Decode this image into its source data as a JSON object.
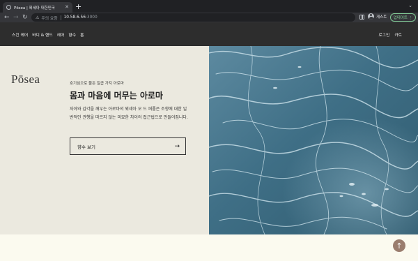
{
  "browser": {
    "tab_title": "Pōsea | 푀세아 대한민국",
    "tab_close": "✕",
    "new_tab": "+",
    "window_chevron": "⌄",
    "address": {
      "security_label": "주의 요함",
      "host": "10.58.6.56",
      "port": ":3000"
    },
    "profile_name": "게스트",
    "update_label": "업데이트 ⋮"
  },
  "site": {
    "nav": [
      "스킨 케어",
      "바디 & 핸드",
      "헤어",
      "향수",
      "홈"
    ],
    "account_nav": [
      "로그인",
      "카트"
    ]
  },
  "hero": {
    "logo": "Pōsea",
    "eyebrow": "호기심으로 물든 일곱 가지 아로마",
    "headline": "몸과 마음에 머무는 아로마",
    "body": "자아와 감각을 깨우는 아로마의 푀세아 오 드 퍼퓸은 조향에 대한 일반적인 관행을 따르지 않는 미묘한 차이의 접근법으로 만들어집니다.",
    "cta_label": "향수 보기",
    "cta_arrow": "→"
  },
  "scroll_top_icon": "↑",
  "colors": {
    "chrome_dark": "#202124",
    "header_bg": "#2d2d2d",
    "hero_left_bg": "#ebe9df",
    "band_bg": "#fbfaef",
    "scroll_top_bg": "#9a7d6e",
    "update_green": "#81c995"
  }
}
